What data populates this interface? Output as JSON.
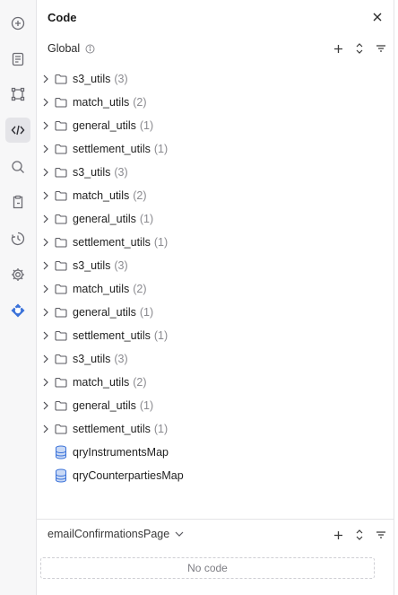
{
  "panel": {
    "title": "Code",
    "global_label": "Global",
    "tree": [
      {
        "name": "s3_utils",
        "count": "(3)"
      },
      {
        "name": "match_utils",
        "count": "(2)"
      },
      {
        "name": "general_utils",
        "count": "(1)"
      },
      {
        "name": "settlement_utils",
        "count": "(1)"
      },
      {
        "name": "s3_utils",
        "count": "(3)"
      },
      {
        "name": "match_utils",
        "count": "(2)"
      },
      {
        "name": "general_utils",
        "count": "(1)"
      },
      {
        "name": "settlement_utils",
        "count": "(1)"
      },
      {
        "name": "s3_utils",
        "count": "(3)"
      },
      {
        "name": "match_utils",
        "count": "(2)"
      },
      {
        "name": "general_utils",
        "count": "(1)"
      },
      {
        "name": "settlement_utils",
        "count": "(1)"
      },
      {
        "name": "s3_utils",
        "count": "(3)"
      },
      {
        "name": "match_utils",
        "count": "(2)"
      },
      {
        "name": "general_utils",
        "count": "(1)"
      },
      {
        "name": "settlement_utils",
        "count": "(1)"
      }
    ],
    "queries": [
      {
        "name": "qryInstrumentsMap"
      },
      {
        "name": "qryCounterpartiesMap"
      }
    ],
    "page_select": "emailConfirmationsPage",
    "no_code": "No code"
  },
  "rail": {
    "items": [
      {
        "icon": "add-circle-icon"
      },
      {
        "icon": "document-icon"
      },
      {
        "icon": "components-icon"
      },
      {
        "icon": "code-icon",
        "active": true
      },
      {
        "icon": "search-icon"
      },
      {
        "icon": "clipboard-icon"
      },
      {
        "icon": "history-icon"
      },
      {
        "icon": "settings-icon"
      },
      {
        "icon": "plugin-icon"
      }
    ]
  },
  "colors": {
    "accent": "#3b72d9",
    "icon": "#5f5f66",
    "muted": "#8a8a8f"
  }
}
